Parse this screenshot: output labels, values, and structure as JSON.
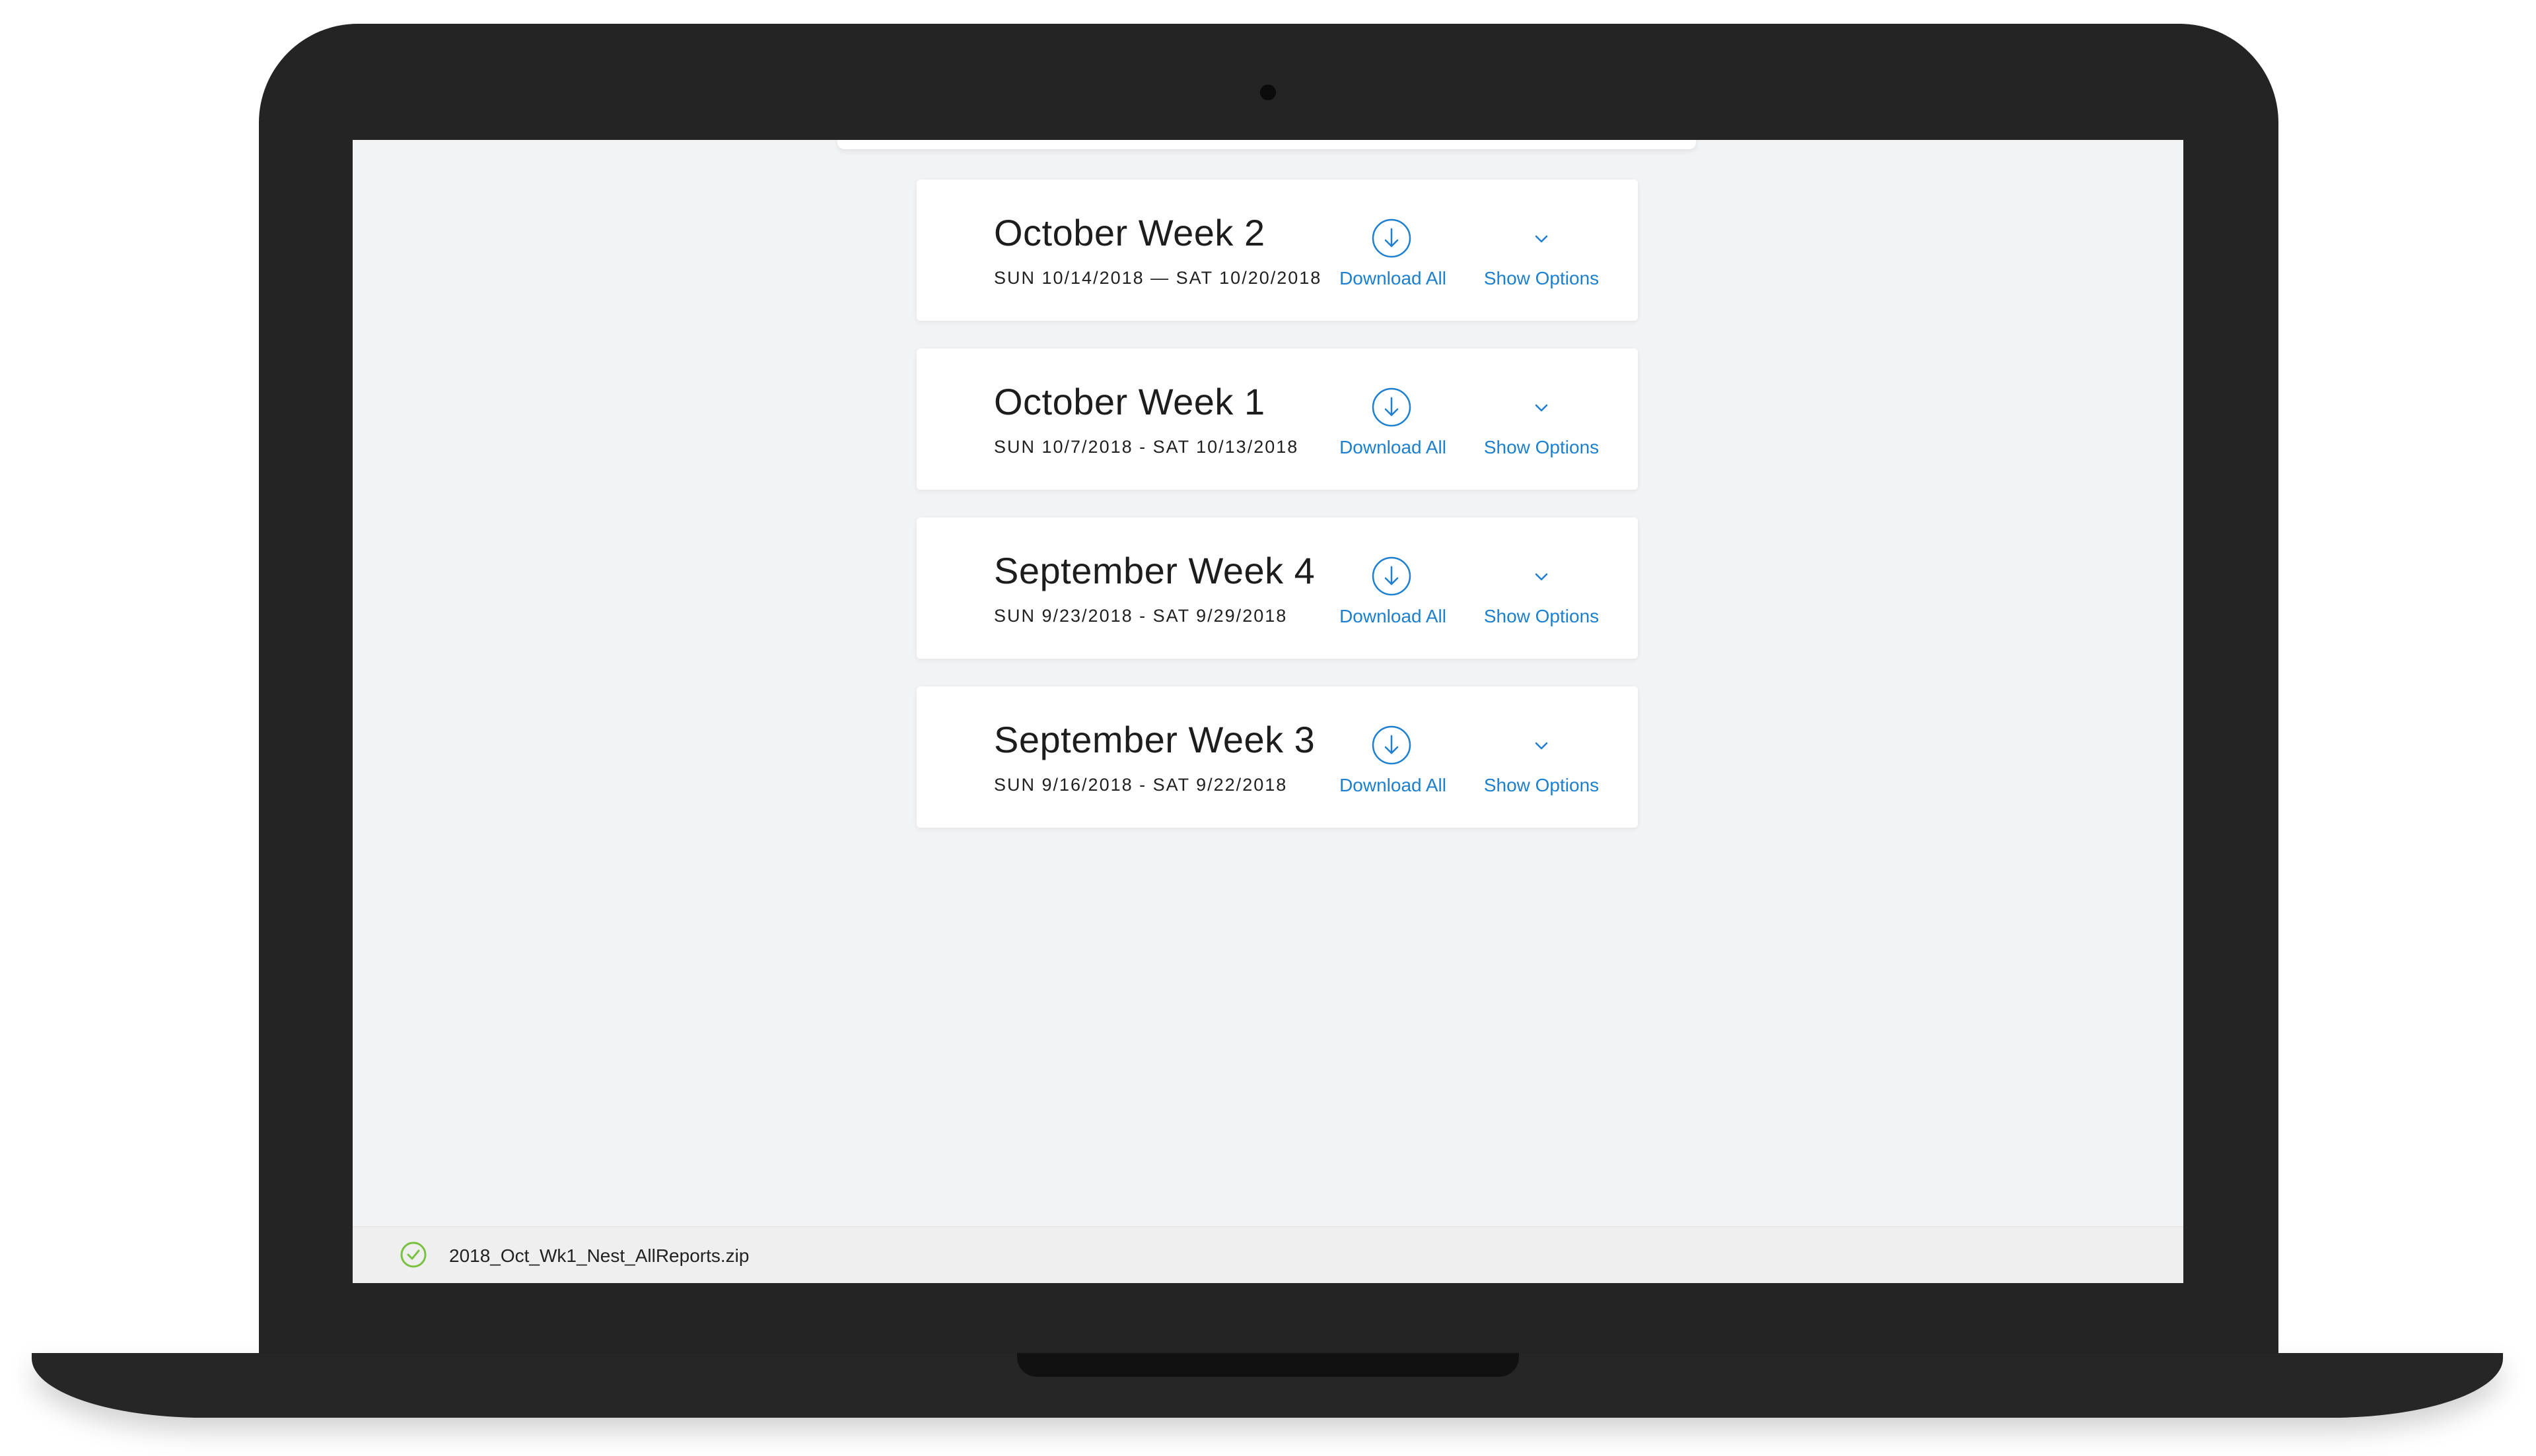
{
  "weeks": [
    {
      "title": "October Week 2",
      "range": "SUN 10/14/2018 — SAT 10/20/2018",
      "download_label": "Download All",
      "options_label": "Show Options"
    },
    {
      "title": "October Week 1",
      "range": "SUN 10/7/2018 - SAT 10/13/2018",
      "download_label": "Download All",
      "options_label": "Show Options"
    },
    {
      "title": "September Week 4",
      "range": "SUN 9/23/2018 - SAT 9/29/2018",
      "download_label": "Download All",
      "options_label": "Show Options"
    },
    {
      "title": "September Week 3",
      "range": "SUN 9/16/2018 - SAT 9/22/2018",
      "download_label": "Download All",
      "options_label": "Show Options"
    }
  ],
  "download_bar": {
    "filename": "2018_Oct_Wk1_Nest_AllReports.zip",
    "status_icon": "check-circle-icon"
  },
  "icons": {
    "download": "download-circle-icon",
    "options": "chevron-down-icon"
  },
  "colors": {
    "accent": "#1d7fcf",
    "success": "#7ac142",
    "screen_background": "#f2f3f5",
    "laptop_frame": "#242424"
  }
}
